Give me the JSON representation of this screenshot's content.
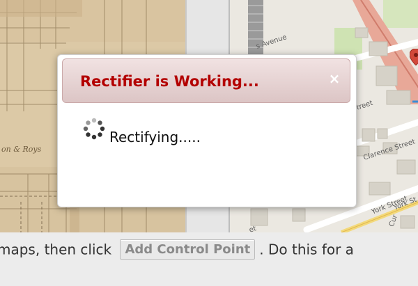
{
  "dialog": {
    "title": "Rectifier is Working...",
    "close_symbol": "×",
    "status_text": "Rectifying.....",
    "spinner_icon": "loading-spinner-icon",
    "title_color": "#b30000"
  },
  "instruction": {
    "text_before": " maps, then click ",
    "button_label": "Add Control Point",
    "text_after": ". Do this for a"
  },
  "old_map": {
    "labels": [
      "on & Roys"
    ]
  },
  "new_map": {
    "street_labels": [
      "s Avenue",
      "treet",
      "Clarence Street",
      "York Street",
      "York St",
      "Cur",
      "et"
    ],
    "marker_icon": "map-pin-icon"
  }
}
